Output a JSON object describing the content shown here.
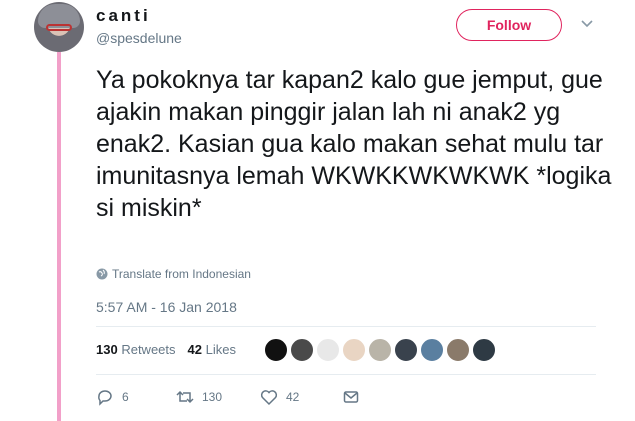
{
  "user": {
    "name": "canti",
    "handle": "@spesdelune"
  },
  "follow_label": "Follow",
  "tweet_text": "Ya pokoknya tar kapan2 kalo gue jemput, gue ajakin makan pinggir jalan lah ni anak2 yg enak2. Kasian gua kalo makan sehat mulu tar imunitasnya lemah WKWKKWKWKWK *logika si miskin*",
  "translate_label": "Translate from Indonesian",
  "timestamp": "5:57 AM - 16 Jan 2018",
  "stats": {
    "retweets_count": "130",
    "retweets_label": "Retweets",
    "likes_count": "42",
    "likes_label": "Likes"
  },
  "liker_colors": [
    "#111111",
    "#4a4a4a",
    "#e8e8e8",
    "#e9d5c3",
    "#b9b4a8",
    "#39424d",
    "#5a7fa0",
    "#8a7a6a",
    "#2e3a44"
  ],
  "actions": {
    "replies": "6",
    "retweets": "130",
    "likes": "42"
  },
  "colors": {
    "accent": "#e0245e",
    "thread_line": "#f2a0c9",
    "muted": "#657786"
  }
}
